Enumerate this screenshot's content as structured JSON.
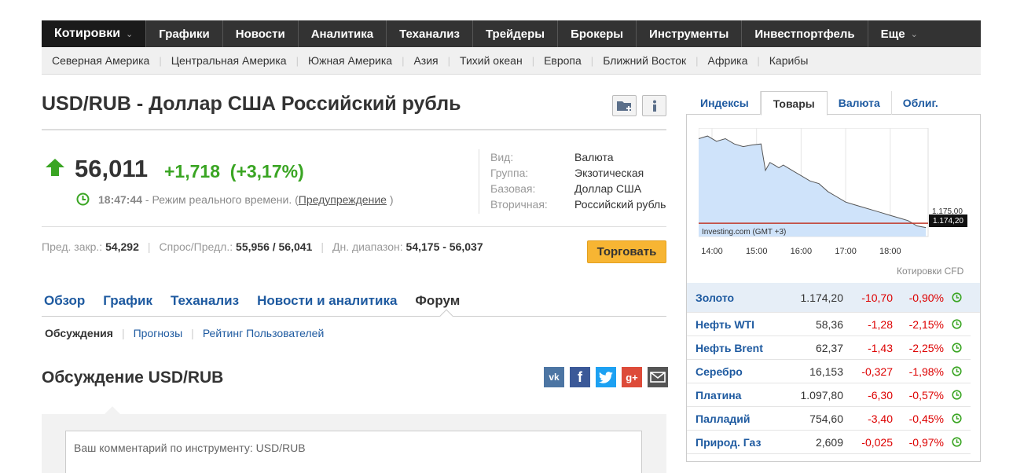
{
  "topnav": {
    "items": [
      "Котировки",
      "Графики",
      "Новости",
      "Аналитика",
      "Теханализ",
      "Трейдеры",
      "Брокеры",
      "Инструменты",
      "Инвестпортфель",
      "Еще"
    ]
  },
  "subnav": {
    "items": [
      "Северная Америка",
      "Центральная Америка",
      "Южная Америка",
      "Азия",
      "Тихий океан",
      "Европа",
      "Ближний Восток",
      "Африка",
      "Карибы"
    ]
  },
  "header": {
    "title": "USD/RUB - Доллар США Российский рубль"
  },
  "quote": {
    "price": "56,011",
    "change": "+1,718",
    "change_pct": "(+3,17%)",
    "time": "18:47:44",
    "realtime_text": " - Режим реального времени. (",
    "warning_link": "Предупреждение",
    "close_paren": " )",
    "colors": {
      "up": "#3aa523",
      "down": "#dd0000",
      "link": "#1e5aa0"
    }
  },
  "info": [
    {
      "key": "Вид:",
      "value": "Валюта"
    },
    {
      "key": "Группа:",
      "value": "Экзотическая"
    },
    {
      "key": "Базовая:",
      "value": "Доллар США"
    },
    {
      "key": "Вторичная:",
      "value": "Российский рубль"
    }
  ],
  "range": {
    "prev_close_label": "Пред. закр.:",
    "prev_close": "54,292",
    "bid_ask_label": "Спрос/Предл.:",
    "bid_ask": "55,956 / 56,041",
    "day_range_label": "Дн. диапазон:",
    "day_range": "54,175 - 56,037"
  },
  "trade_button": "Торговать",
  "section_tabs": [
    "Обзор",
    "График",
    "Теханализ",
    "Новости и аналитика",
    "Форум"
  ],
  "subtabs": [
    "Обсуждения",
    "Прогнозы",
    "Рейтинг Пользователей"
  ],
  "discussion": {
    "title": "Обсуждение USD/RUB",
    "placeholder": "Ваш комментарий по инструменту: USD/RUB"
  },
  "share_icons": [
    "vk-icon",
    "facebook-icon",
    "twitter-icon",
    "google-plus-icon",
    "email-icon"
  ],
  "widget": {
    "tabs": [
      "Индексы",
      "Товары",
      "Валюта",
      "Облиг."
    ],
    "chart_source": "Investing.com (GMT +3)",
    "cfd_label": "Котировки CFD",
    "price_tag": "1.174,20",
    "price_tag_behind": "1.175,00",
    "commodities": [
      {
        "name": "Золото",
        "last": "1.174,20",
        "chg": "-10,70",
        "pct": "-0,90%"
      },
      {
        "name": "Нефть WTI",
        "last": "58,36",
        "chg": "-1,28",
        "pct": "-2,15%"
      },
      {
        "name": "Нефть Brent",
        "last": "62,37",
        "chg": "-1,43",
        "pct": "-2,25%"
      },
      {
        "name": "Серебро",
        "last": "16,153",
        "chg": "-0,327",
        "pct": "-1,98%"
      },
      {
        "name": "Платина",
        "last": "1.097,80",
        "chg": "-6,30",
        "pct": "-0,57%"
      },
      {
        "name": "Палладий",
        "last": "754,60",
        "chg": "-3,40",
        "pct": "-0,45%"
      },
      {
        "name": "Природ. Газ",
        "last": "2,609",
        "chg": "-0,025",
        "pct": "-0,97%"
      }
    ]
  },
  "chart_data": {
    "type": "area",
    "x_ticks": [
      "14:00",
      "15:00",
      "16:00",
      "17:00",
      "18:00"
    ],
    "x_hours": [
      13.7,
      13.9,
      14.1,
      14.3,
      14.5,
      14.7,
      14.9,
      15.1,
      15.2,
      15.3,
      15.4,
      15.5,
      15.6,
      15.8,
      16.0,
      16.2,
      16.4,
      16.6,
      16.8,
      17.0,
      17.2,
      17.4,
      17.6,
      17.8,
      18.0,
      18.2,
      18.4,
      18.6,
      18.8
    ],
    "values": [
      1191,
      1191.5,
      1190.5,
      1191,
      1190,
      1189.5,
      1189.8,
      1190,
      1185,
      1186.5,
      1186,
      1185.5,
      1186,
      1185,
      1184,
      1183,
      1182.5,
      1181,
      1180,
      1179,
      1178.5,
      1178,
      1177.5,
      1177,
      1176.5,
      1176,
      1175.5,
      1174.5,
      1174.2
    ],
    "xlim": [
      13.7,
      18.85
    ],
    "ylim": [
      1172.5,
      1193
    ],
    "reference_line": 1175.0
  }
}
